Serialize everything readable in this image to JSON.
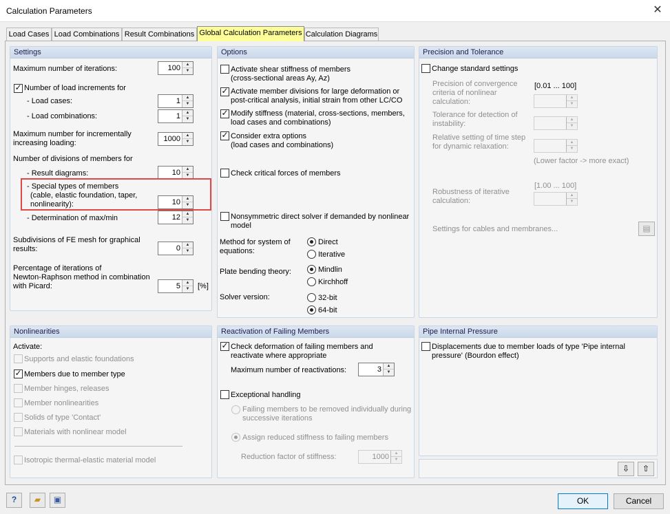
{
  "window": {
    "title": "Calculation Parameters",
    "close": "✕"
  },
  "tabs": [
    "Load Cases",
    "Load Combinations",
    "Result Combinations",
    "Global Calculation Parameters",
    "Calculation Diagrams"
  ],
  "settings": {
    "header": "Settings",
    "max_iter_label": "Maximum number of iterations:",
    "max_iter": "100",
    "load_incr_label": "Number of load increments for",
    "load_incr_checked": true,
    "load_cases_label": "- Load cases:",
    "load_cases": "1",
    "load_combos_label": "- Load combinations:",
    "load_combos": "1",
    "max_incr_line1": "Maximum number for incrementally",
    "max_incr_line2": "increasing loading:",
    "max_incr": "1000",
    "divisions_label": "Number of divisions of members for",
    "result_diagrams_label": "- Result diagrams:",
    "result_diagrams": "10",
    "special_line1": "- Special types of members",
    "special_line2": "(cable, elastic foundation, taper,",
    "special_line3": "nonlinearity):",
    "special": "10",
    "maxmin_label": "- Determination of max/min",
    "maxmin": "12",
    "fe_mesh_line1": "Subdivisions of FE mesh for graphical",
    "fe_mesh_line2": "results:",
    "fe_mesh": "0",
    "picard_line1": "Percentage of iterations of",
    "picard_line2": "Newton-Raphson method in combination",
    "picard_line3": "with Picard:",
    "picard": "5",
    "picard_unit": "[%]"
  },
  "options": {
    "header": "Options",
    "shear_line1": "Activate shear stiffness of members",
    "shear_line2": "(cross-sectional areas Ay, Az)",
    "shear_checked": false,
    "divisions_line1": "Activate member divisions for large deformation or",
    "divisions_line2": "post-critical analysis, initial strain from other LC/CO",
    "divisions_checked": true,
    "modify_line1": "Modify stiffness (material, cross-sections, members,",
    "modify_line2": "load cases and combinations)",
    "modify_checked": true,
    "extra_line1": "Consider extra options",
    "extra_line2": "(load cases and combinations)",
    "extra_checked": true,
    "critical": "Check critical forces of members",
    "critical_checked": false,
    "nonsym_line1": "Nonsymmetric direct solver if demanded by nonlinear",
    "nonsym_line2": "model",
    "nonsym_checked": false,
    "method_line1": "Method for system of",
    "method_line2": "equations:",
    "method_direct": "Direct",
    "method_iterative": "Iterative",
    "method_selected": "Direct",
    "plate_label": "Plate bending theory:",
    "plate_mindlin": "Mindlin",
    "plate_kirchhoff": "Kirchhoff",
    "plate_selected": "Mindlin",
    "solver_label": "Solver version:",
    "solver_32": "32-bit",
    "solver_64": "64-bit",
    "solver_selected": "64-bit"
  },
  "precision": {
    "header": "Precision and Tolerance",
    "change": "Change standard settings",
    "change_checked": false,
    "conv_line1": "Precision of convergence",
    "conv_line2": "criteria of nonlinear",
    "conv_line3": "calculation:",
    "conv_range": "[0.01 ... 100]",
    "instab_line1": "Tolerance for detection of",
    "instab_line2": "instability:",
    "relax_line1": "Relative setting of time step",
    "relax_line2": "for dynamic relaxation:",
    "lower_note": "(Lower factor -> more exact)",
    "robust_range": "[1.00 ... 100]",
    "robust_line1": "Robustness of iterative",
    "robust_line2": "calculation:",
    "cables": "Settings for cables and membranes..."
  },
  "nonlinearities": {
    "header": "Nonlinearities",
    "activate": "Activate:",
    "items": [
      {
        "label": "Supports and elastic foundations",
        "checked": false,
        "enabled": false
      },
      {
        "label": "Members due to member type",
        "checked": true,
        "enabled": true
      },
      {
        "label": "Member hinges, releases",
        "checked": false,
        "enabled": false
      },
      {
        "label": "Member nonlinearities",
        "checked": false,
        "enabled": false
      },
      {
        "label": "Solids of type 'Contact'",
        "checked": false,
        "enabled": false
      },
      {
        "label": "Materials with nonlinear model",
        "checked": false,
        "enabled": false
      }
    ],
    "thermal": "Isotropic thermal-elastic material model"
  },
  "failing": {
    "header": "Reactivation of Failing Members",
    "check_line1": "Check deformation of failing members and",
    "check_line2": "reactivate where appropriate",
    "check_checked": true,
    "max_react_label": "Maximum number of reactivations:",
    "max_react": "3",
    "exceptional": "Exceptional handling",
    "exceptional_checked": false,
    "remove_line1": "Failing members to be removed individually during",
    "remove_line2": "successive iterations",
    "assign": "Assign reduced stiffness to failing members",
    "reduction_label": "Reduction factor of stiffness:",
    "reduction": "1000"
  },
  "pipe": {
    "header": "Pipe Internal Pressure",
    "line1": "Displacements due to member loads of type 'Pipe internal",
    "line2": "pressure' (Bourdon effect)",
    "checked": false
  },
  "footer": {
    "ok": "OK",
    "cancel": "Cancel"
  }
}
